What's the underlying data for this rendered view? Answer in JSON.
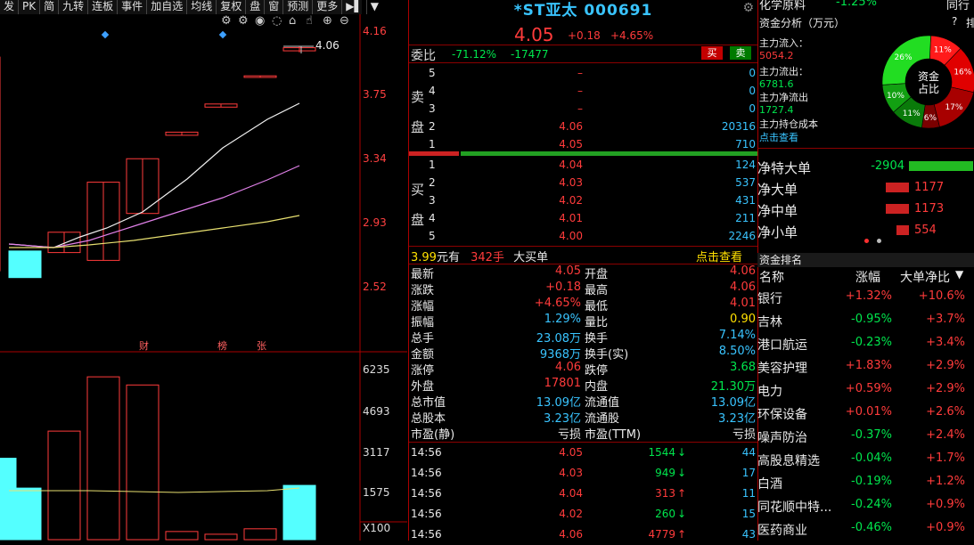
{
  "toolbar": {
    "items": [
      "发",
      "PK",
      "简",
      "九转",
      "连板",
      "事件",
      "加自选",
      "均线",
      "复权",
      "盘",
      "窗",
      "预测",
      "更多"
    ]
  },
  "chart": {
    "price_axis": [
      "4.16",
      "3.75",
      "3.34",
      "2.93",
      "2.52"
    ],
    "volume_axis": [
      "6235",
      "4693",
      "3117",
      "1575"
    ],
    "volume_unit": "X100",
    "last_price_tag": "4.06",
    "event_labels": [
      "财",
      "榜",
      "张"
    ],
    "candles": [
      {
        "open": 3.2,
        "close": 4.0,
        "high": 4.0,
        "low": 2.63,
        "color": "#ff3b3b"
      },
      {
        "open": 2.76,
        "close": 2.59,
        "high": 2.76,
        "low": 2.59,
        "color": "#54ffff"
      },
      {
        "open": 2.75,
        "close": 2.88,
        "high": 2.88,
        "low": 2.75,
        "color": "#ff3b3b"
      },
      {
        "open": 2.7,
        "close": 3.2,
        "high": 3.2,
        "low": 2.7,
        "color": "#ff3b3b"
      },
      {
        "open": 3.0,
        "close": 3.35,
        "high": 3.35,
        "low": 3.0,
        "color": "#ff3b3b"
      },
      {
        "open": 3.5,
        "close": 3.52,
        "high": 3.52,
        "low": 3.5,
        "color": "#ff3b3b"
      },
      {
        "open": 3.68,
        "close": 3.7,
        "high": 3.7,
        "low": 3.68,
        "color": "#ff3b3b"
      },
      {
        "open": 3.87,
        "close": 3.88,
        "high": 3.88,
        "low": 3.87,
        "color": "#ff3b3b"
      },
      {
        "open": 4.04,
        "close": 4.06,
        "high": 4.07,
        "low": 4.03,
        "color": "#ff3b3b"
      }
    ],
    "volumes": [
      {
        "value": 3000,
        "color": "#54ffff"
      },
      {
        "value": 1900,
        "color": "#54ffff"
      },
      {
        "value": 4000,
        "color": "#ff3b3b"
      },
      {
        "value": 6000,
        "color": "#ff3b3b"
      },
      {
        "value": 5700,
        "color": "#ff3b3b"
      },
      {
        "value": 300,
        "color": "#ff3b3b"
      },
      {
        "value": 200,
        "color": "#ff3b3b"
      },
      {
        "value": 400,
        "color": "#ff3b3b"
      },
      {
        "value": 2000,
        "color": "#54ffff"
      }
    ]
  },
  "quote": {
    "title": "*ST亚太 000691",
    "price": "4.05",
    "change": "+0.18",
    "change_pct": "+4.65%",
    "weibi_label": "委比",
    "weibi_pct": "-71.12%",
    "weibi_val": "-17477",
    "buy_btn": "买",
    "sell_btn": "卖",
    "sell_label": [
      "卖",
      "盘"
    ],
    "buy_label": [
      "买",
      "盘"
    ],
    "sell_orders": [
      {
        "level": "5",
        "price": "–",
        "vol": "0"
      },
      {
        "level": "4",
        "price": "–",
        "vol": "0"
      },
      {
        "level": "3",
        "price": "–",
        "vol": "0"
      },
      {
        "level": "2",
        "price": "4.06",
        "vol": "20316"
      },
      {
        "level": "1",
        "price": "4.05",
        "vol": "710"
      }
    ],
    "buy_orders": [
      {
        "level": "1",
        "price": "4.04",
        "vol": "124"
      },
      {
        "level": "2",
        "price": "4.03",
        "vol": "537"
      },
      {
        "level": "3",
        "price": "4.02",
        "vol": "431"
      },
      {
        "level": "4",
        "price": "4.01",
        "vol": "211"
      },
      {
        "level": "5",
        "price": "4.00",
        "vol": "2246"
      }
    ],
    "big_order": {
      "amount": "3.99",
      "unit": "元有",
      "hands": "342手",
      "label": "大买单",
      "link": "点击查看"
    },
    "stats_left": [
      {
        "k": "最新",
        "v": "4.05",
        "c": "red"
      },
      {
        "k": "涨跌",
        "v": "+0.18",
        "c": "red"
      },
      {
        "k": "涨幅",
        "v": "+4.65%",
        "c": "red"
      },
      {
        "k": "振幅",
        "v": "1.29%",
        "c": "cyan"
      },
      {
        "k": "总手",
        "v": "23.08万",
        "c": "cyan"
      },
      {
        "k": "金额",
        "v": "9368万",
        "c": "cyan"
      },
      {
        "k": "涨停",
        "v": "4.06",
        "c": "red"
      },
      {
        "k": "外盘",
        "v": "17801",
        "c": "red"
      },
      {
        "k": "总市值",
        "v": "13.09亿",
        "c": "cyan"
      },
      {
        "k": "总股本",
        "v": "3.23亿",
        "c": "cyan"
      },
      {
        "k": "市盈(静)",
        "v": "亏损",
        "c": "white"
      }
    ],
    "stats_right": [
      {
        "k": "开盘",
        "v": "4.06",
        "c": "red"
      },
      {
        "k": "最高",
        "v": "4.06",
        "c": "red"
      },
      {
        "k": "最低",
        "v": "4.01",
        "c": "red"
      },
      {
        "k": "量比",
        "v": "0.90",
        "c": "yellow"
      },
      {
        "k": "换手",
        "v": "7.14%",
        "c": "cyan"
      },
      {
        "k": "换手(实)",
        "v": "8.50%",
        "c": "cyan"
      },
      {
        "k": "跌停",
        "v": "3.68",
        "c": "green"
      },
      {
        "k": "内盘",
        "v": "21.30万",
        "c": "green"
      },
      {
        "k": "流通值",
        "v": "13.09亿",
        "c": "cyan"
      },
      {
        "k": "流通股",
        "v": "3.23亿",
        "c": "cyan"
      },
      {
        "k": "市盈(TTM)",
        "v": "亏损",
        "c": "white"
      }
    ],
    "ticks": [
      {
        "time": "14:56",
        "price": "4.05",
        "vol": "1544",
        "dir": "down",
        "n": "44"
      },
      {
        "time": "14:56",
        "price": "4.03",
        "vol": "949",
        "dir": "down",
        "n": "17"
      },
      {
        "time": "14:56",
        "price": "4.04",
        "vol": "313",
        "dir": "up",
        "n": "11"
      },
      {
        "time": "14:56",
        "price": "4.02",
        "vol": "260",
        "dir": "down",
        "n": "15"
      },
      {
        "time": "14:56",
        "price": "4.06",
        "vol": "4779",
        "dir": "up",
        "n": "43"
      }
    ]
  },
  "right": {
    "top_name": "化学原料",
    "top_pct": "-1.25%",
    "top_more": "同行",
    "fund_title": "资金分析（万元）",
    "help": "?",
    "help2": "排",
    "inflow_label": "主力流入：",
    "inflow": "5054.2",
    "outflow_label": "主力流出：",
    "outflow": "6781.6",
    "net_label": "主力净流出",
    "net": "1727.4",
    "cost_label": "主力持仓成本",
    "cost_link": "点击查看",
    "donut_center": [
      "资金",
      "占比"
    ],
    "donut_slices": [
      {
        "label": "11%",
        "value": 11,
        "color": "#ff1a1a"
      },
      {
        "label": "16%",
        "value": 16,
        "color": "#e00000"
      },
      {
        "label": "17%",
        "value": 17,
        "color": "#a80000"
      },
      {
        "label": "6%",
        "value": 6,
        "color": "#7a0000"
      },
      {
        "label": "11%",
        "value": 11,
        "color": "#0a7a0a"
      },
      {
        "label": "10%",
        "value": 10,
        "color": "#12a012"
      },
      {
        "label": "26%",
        "value": 26,
        "color": "#22dd22"
      }
    ],
    "flows": [
      {
        "label": "净特大单",
        "val": "-2904",
        "color": "#22bb22",
        "fraction": 1.0
      },
      {
        "label": "净大单",
        "val": "1177",
        "color": "#cc2222",
        "fraction": 0.36
      },
      {
        "label": "净中单",
        "val": "1173",
        "color": "#cc2222",
        "fraction": 0.36
      },
      {
        "label": "净小单",
        "val": "554",
        "color": "#cc2222",
        "fraction": 0.2
      }
    ],
    "rank_title": "资金排名",
    "rank_headers": [
      "名称",
      "涨幅",
      "大单净比"
    ],
    "rank": [
      {
        "name": "银行",
        "pct": "+1.32%",
        "net": "+10.6%"
      },
      {
        "name": "吉林",
        "pct": "-0.95%",
        "net": "+3.7%"
      },
      {
        "name": "港口航运",
        "pct": "-0.23%",
        "net": "+3.4%"
      },
      {
        "name": "美容护理",
        "pct": "+1.83%",
        "net": "+2.9%"
      },
      {
        "name": "电力",
        "pct": "+0.59%",
        "net": "+2.9%"
      },
      {
        "name": "环保设备",
        "pct": "+0.01%",
        "net": "+2.6%"
      },
      {
        "name": "噪声防治",
        "pct": "-0.37%",
        "net": "+2.4%"
      },
      {
        "name": "高股息精选",
        "pct": "-0.04%",
        "net": "+1.7%"
      },
      {
        "name": "白酒",
        "pct": "-0.19%",
        "net": "+1.2%"
      },
      {
        "name": "同花顺中特...",
        "pct": "-0.24%",
        "net": "+0.9%"
      },
      {
        "name": "医药商业",
        "pct": "-0.46%",
        "net": "+0.9%"
      }
    ]
  }
}
